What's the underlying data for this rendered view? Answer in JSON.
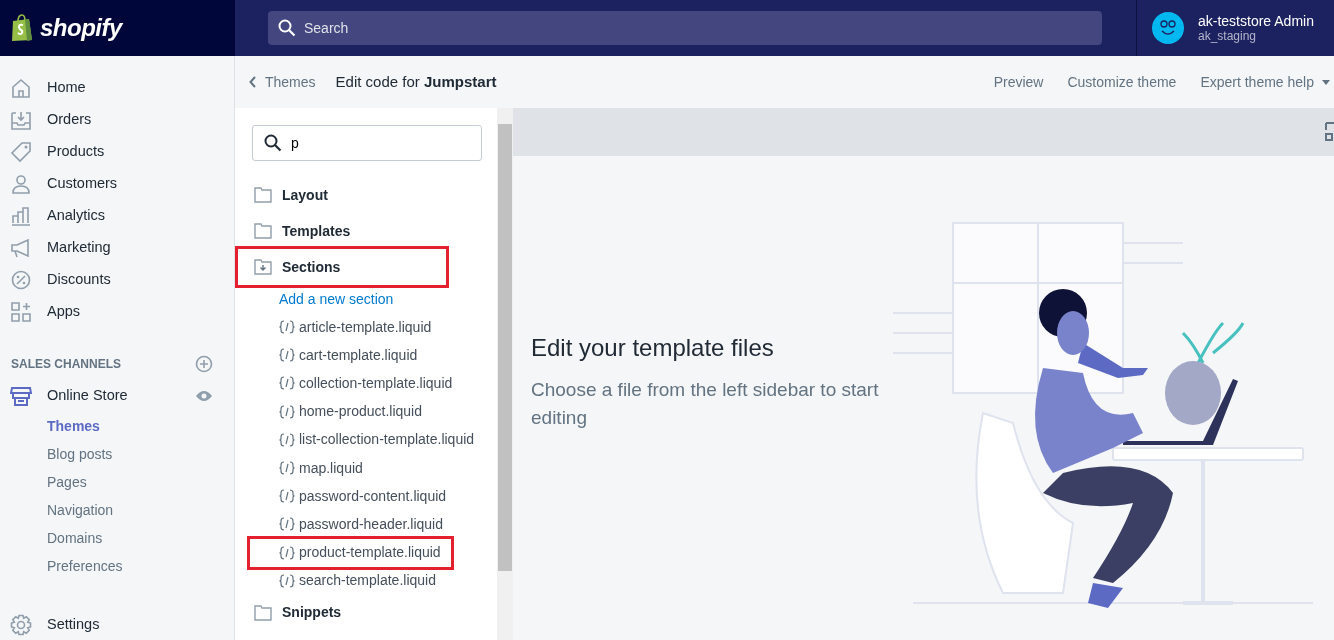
{
  "topbar": {
    "logo_text": "shopify",
    "search": {
      "placeholder": "Search"
    },
    "account": {
      "name": "ak-teststore Admin",
      "store": "ak_staging"
    }
  },
  "nav": {
    "items": [
      {
        "label": "Home"
      },
      {
        "label": "Orders"
      },
      {
        "label": "Products"
      },
      {
        "label": "Customers"
      },
      {
        "label": "Analytics"
      },
      {
        "label": "Marketing"
      },
      {
        "label": "Discounts"
      },
      {
        "label": "Apps"
      }
    ],
    "sales_channels": {
      "heading": "SALES CHANNELS",
      "channel": {
        "label": "Online Store",
        "items": [
          {
            "label": "Themes",
            "selected": true
          },
          {
            "label": "Blog posts",
            "selected": false
          },
          {
            "label": "Pages",
            "selected": false
          },
          {
            "label": "Navigation",
            "selected": false
          },
          {
            "label": "Domains",
            "selected": false
          },
          {
            "label": "Preferences",
            "selected": false
          }
        ]
      }
    },
    "settings": {
      "label": "Settings"
    }
  },
  "header": {
    "back": "Themes",
    "title": "Edit code for **Jumpstart**",
    "actions": [
      {
        "label": "Preview",
        "kind": "link"
      },
      {
        "label": "Customize theme",
        "kind": "link"
      },
      {
        "label": "Expert theme help",
        "kind": "dropdown"
      }
    ]
  },
  "files": {
    "search": {
      "value": "p"
    },
    "folders": [
      {
        "name": "Layout",
        "expanded": false,
        "highlighted": false
      },
      {
        "name": "Templates",
        "expanded": false,
        "highlighted": false
      },
      {
        "name": "Sections",
        "expanded": true,
        "highlighted": true,
        "add_link": "Add a new section",
        "children": [
          {
            "name": "article-template.liquid",
            "highlighted": false
          },
          {
            "name": "cart-template.liquid",
            "highlighted": false
          },
          {
            "name": "collection-template.liquid",
            "highlighted": false
          },
          {
            "name": "home-product.liquid",
            "highlighted": false
          },
          {
            "name": "list-collection-template.liquid",
            "highlighted": false
          },
          {
            "name": "map.liquid",
            "highlighted": false
          },
          {
            "name": "password-content.liquid",
            "highlighted": false
          },
          {
            "name": "password-header.liquid",
            "highlighted": false
          },
          {
            "name": "product-template.liquid",
            "highlighted": true
          },
          {
            "name": "search-template.liquid",
            "highlighted": false
          }
        ]
      },
      {
        "name": "Snippets",
        "expanded": false,
        "highlighted": false
      }
    ]
  },
  "empty_state": {
    "title": "Edit your template files",
    "text": "Choose a file from the left sidebar to start editing"
  }
}
